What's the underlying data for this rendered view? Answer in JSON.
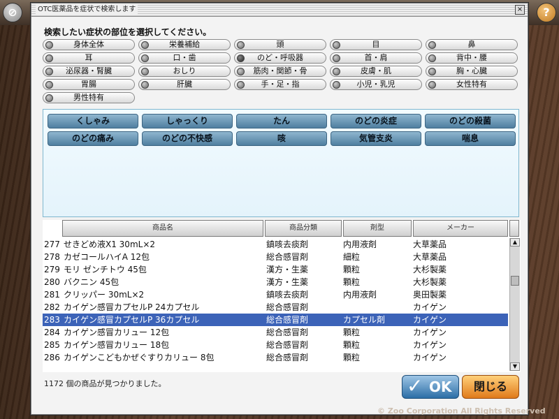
{
  "dialog": {
    "title": "OTC医薬品を症状で検索します",
    "close_glyph": "×",
    "prompt": "検索したい症状の部位を選択してください。",
    "body_parts": [
      {
        "label": "身体全体",
        "selected": false
      },
      {
        "label": "栄養補給",
        "selected": false
      },
      {
        "label": "頭",
        "selected": false
      },
      {
        "label": "目",
        "selected": false
      },
      {
        "label": "鼻",
        "selected": false
      },
      {
        "label": "耳",
        "selected": false
      },
      {
        "label": "口・歯",
        "selected": false
      },
      {
        "label": "のど・呼吸器",
        "selected": true
      },
      {
        "label": "首・肩",
        "selected": false
      },
      {
        "label": "背中・腰",
        "selected": false
      },
      {
        "label": "泌尿器・腎臓",
        "selected": false
      },
      {
        "label": "おしり",
        "selected": false
      },
      {
        "label": "筋肉・関節・骨",
        "selected": false
      },
      {
        "label": "皮膚・肌",
        "selected": false
      },
      {
        "label": "胸・心臓",
        "selected": false
      },
      {
        "label": "胃腸",
        "selected": false
      },
      {
        "label": "肝臓",
        "selected": false
      },
      {
        "label": "手・足・指",
        "selected": false
      },
      {
        "label": "小児・乳児",
        "selected": false
      },
      {
        "label": "女性特有",
        "selected": false
      },
      {
        "label": "男性特有",
        "selected": false
      }
    ],
    "symptoms": [
      "くしゃみ",
      "しゃっくり",
      "たん",
      "のどの炎症",
      "のどの殺菌",
      "のどの痛み",
      "のどの不快感",
      "咳",
      "気管支炎",
      "喘息"
    ],
    "table": {
      "headers": [
        "商品名",
        "商品分類",
        "剤型",
        "メーカー"
      ],
      "rows": [
        {
          "no": "277",
          "name": "せきどめ液X1 30mL×2",
          "category": "鎮咳去痰剤",
          "form": "内用液剤",
          "maker": "大草薬品",
          "selected": false
        },
        {
          "no": "278",
          "name": "カゼコールハイA 12包",
          "category": "総合感冒剤",
          "form": "細粒",
          "maker": "大草薬品",
          "selected": false
        },
        {
          "no": "279",
          "name": "モリ ゼンチトウ 45包",
          "category": "漢方・生薬",
          "form": "顆粒",
          "maker": "大杉製薬",
          "selected": false
        },
        {
          "no": "280",
          "name": "バクニン 45包",
          "category": "漢方・生薬",
          "form": "顆粒",
          "maker": "大杉製薬",
          "selected": false
        },
        {
          "no": "281",
          "name": "クリッパー 30mL×2",
          "category": "鎮咳去痰剤",
          "form": "内用液剤",
          "maker": "奥田製薬",
          "selected": false
        },
        {
          "no": "282",
          "name": "カイゲン感冒カプセルP 24カプセル",
          "category": "総合感冒剤",
          "form": "",
          "maker": "カイゲン",
          "selected": false
        },
        {
          "no": "283",
          "name": "カイゲン感冒カプセルP 36カプセル",
          "category": "総合感冒剤",
          "form": "カプセル剤",
          "maker": "カイゲン",
          "selected": true
        },
        {
          "no": "284",
          "name": "カイゲン感冒カリュー 12包",
          "category": "総合感冒剤",
          "form": "顆粒",
          "maker": "カイゲン",
          "selected": false
        },
        {
          "no": "285",
          "name": "カイゲン感冒カリュー 18包",
          "category": "総合感冒剤",
          "form": "顆粒",
          "maker": "カイゲン",
          "selected": false
        },
        {
          "no": "286",
          "name": "カイゲンこどもかぜぐすりカリュー 8包",
          "category": "総合感冒剤",
          "form": "顆粒",
          "maker": "カイゲン",
          "selected": false
        }
      ]
    },
    "result_text": "1172 個の商品が見つかりました。",
    "ok_label": "OK",
    "close_label": "閉じる"
  },
  "topbar": {
    "help_glyph": "?"
  },
  "copyright": "© Zoo Corporation All Rights Reserved"
}
